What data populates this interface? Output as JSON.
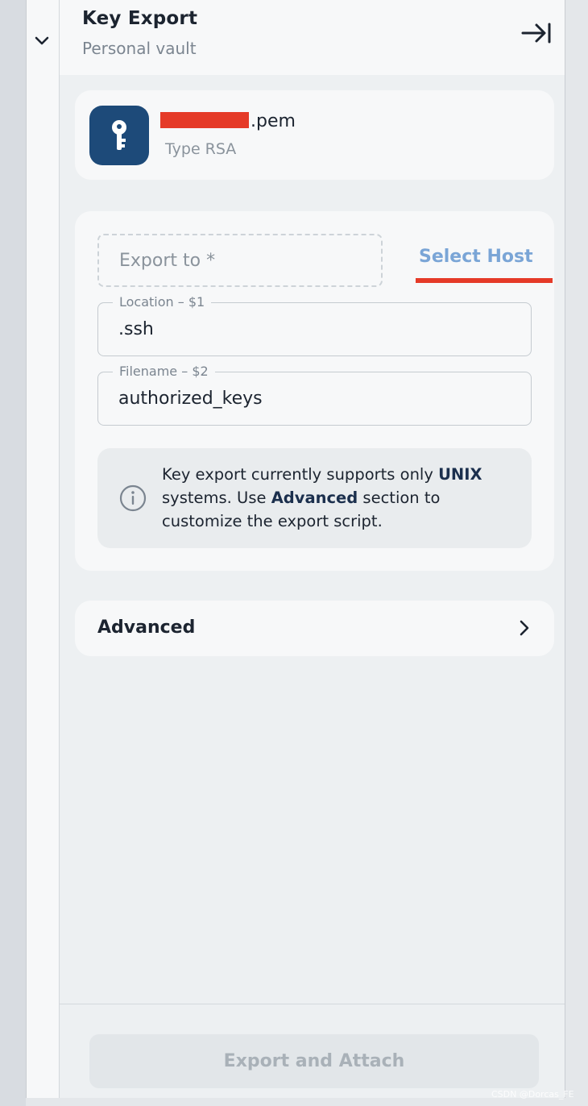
{
  "header": {
    "title": "Key Export",
    "subtitle": "Personal vault"
  },
  "key": {
    "name_suffix": ".pem",
    "type": "Type RSA"
  },
  "form": {
    "export_to_placeholder": "Export to *",
    "select_host_label": "Select Host",
    "location": {
      "label": "Location – $1",
      "value": ".ssh"
    },
    "filename": {
      "label": "Filename – $2",
      "value": "authorized_keys"
    }
  },
  "info": {
    "part1": "Key export currently supports only ",
    "bold1": "UNIX",
    "part2": " systems. Use ",
    "bold2": "Advanced",
    "part3": " section to customize the export script."
  },
  "advanced": {
    "label": "Advanced"
  },
  "footer": {
    "export_button_label": "Export and Attach"
  },
  "watermark": "CSDN @Dorcas_FE",
  "colors": {
    "accent": "#7aa5d6",
    "key_icon_bg": "#1d4a79",
    "annotation_red": "#e53a28",
    "disabled_text": "#a9b1b8"
  },
  "icons": {
    "collapse": "chevron-down-icon",
    "close_panel": "arrow-to-right-icon",
    "key_avatar": "key-icon",
    "info": "info-icon",
    "advanced": "chevron-right-icon"
  }
}
